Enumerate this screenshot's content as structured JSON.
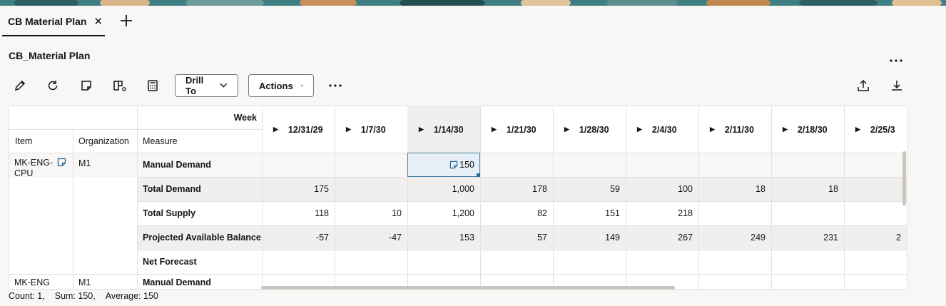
{
  "tabs": [
    {
      "label": "CB Material Plan",
      "active": true
    }
  ],
  "page": {
    "title": "CB_Material Plan"
  },
  "toolbar": {
    "icons": [
      "edit-icon",
      "refresh-icon",
      "note-icon",
      "layout-icon",
      "calculator-icon"
    ],
    "drill_to_label": "Drill To",
    "actions_label": "Actions",
    "more_icon": "ellipsis-icon",
    "export_icon": "export-icon",
    "download_icon": "download-icon"
  },
  "grid": {
    "week_label": "Week",
    "headers": {
      "item": "Item",
      "organization": "Organization",
      "measure": "Measure"
    },
    "weeks": [
      "12/31/29",
      "1/7/30",
      "1/14/30",
      "1/21/30",
      "1/28/30",
      "2/4/30",
      "2/11/30",
      "2/18/30",
      "2/25/3"
    ],
    "item": "MK-ENG-CPU",
    "item_line1": "MK-ENG-",
    "item_line2": "CPU",
    "organization": "M1",
    "rows": [
      {
        "measure": "Manual Demand",
        "values": [
          "",
          "",
          "150",
          "",
          "",
          "",
          "",
          "",
          ""
        ]
      },
      {
        "measure": "Total Demand",
        "values": [
          "175",
          "",
          "1,000",
          "178",
          "59",
          "100",
          "18",
          "18",
          ""
        ]
      },
      {
        "measure": "Total Supply",
        "values": [
          "118",
          "10",
          "1,200",
          "82",
          "151",
          "218",
          "",
          "",
          ""
        ]
      },
      {
        "measure": "Projected Available Balance",
        "values": [
          "-57",
          "-47",
          "153",
          "57",
          "149",
          "267",
          "249",
          "231",
          "2"
        ]
      },
      {
        "measure": "Net Forecast",
        "values": [
          "",
          "",
          "",
          "",
          "",
          "",
          "",
          "",
          ""
        ]
      }
    ],
    "next_item": "MK-ENG",
    "next_org": "M1",
    "next_measure": "Manual Demand"
  },
  "status": {
    "count": "Count: 1,",
    "sum": "Sum: 150,",
    "average": "Average: 150"
  },
  "colors": {
    "accent": "#2a6a93",
    "selected_bg": "#e6f0f6",
    "row_alt": "#f1efed",
    "border": "#e4e1dd"
  }
}
